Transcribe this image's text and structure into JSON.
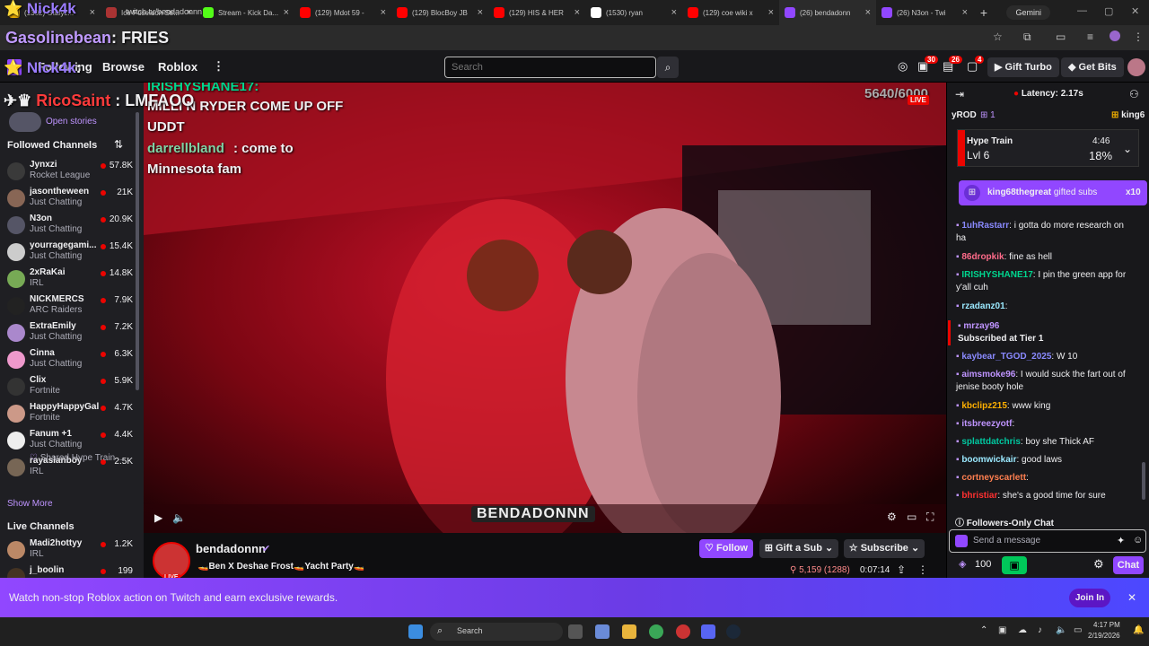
{
  "browser": {
    "tabs": [
      {
        "label": "(1302) Gabyz...",
        "color": "#e6a800"
      },
      {
        "label": "Ice Poseidon Str...",
        "color": "#a33"
      },
      {
        "label": "Stream - Kick Da...",
        "color": "#53fc18"
      },
      {
        "label": "(129) Mdot 59 -",
        "color": "#f00"
      },
      {
        "label": "(129) BlocBoy JB",
        "color": "#f00"
      },
      {
        "label": "(129) HIS & HER",
        "color": "#f00"
      },
      {
        "label": "(1530) ryan",
        "color": "#fff"
      },
      {
        "label": "(129) coe wiki x",
        "color": "#f00"
      },
      {
        "label": "(26) bendadonn",
        "color": "#9147ff"
      },
      {
        "label": "(26) N3on - Twi",
        "color": "#9147ff"
      }
    ],
    "new_tab": "+",
    "gemini": "Gemini",
    "url": "twitch.tv/bendadonnn"
  },
  "overlays": {
    "top_user": "Nick4k",
    "msg1_user": "Gasolinebean",
    "msg1_sep": ":",
    "msg1_text": "FRIES",
    "msg2_user": "Nick4k",
    "msg2_sep": ":",
    "msg3_user": "RicoSaint",
    "msg3_sep": ":",
    "msg3_text": "LMFAOO"
  },
  "nav": {
    "following": "Following",
    "browse": "Browse",
    "roblox": "Roblox",
    "search_placeholder": "Search",
    "badge_a": "30",
    "badge_b": "26",
    "badge_c": "4",
    "gift_turbo": "Gift Turbo",
    "get_bits": "Get Bits"
  },
  "sidebar": {
    "open_stories": "Open stories",
    "followed_header": "Followed Channels",
    "followed": [
      {
        "name": "Jynxzi",
        "game": "Rocket League",
        "viewers": "57.8K",
        "color": "#3a3a3a"
      },
      {
        "name": "jasontheween",
        "game": "Just Chatting",
        "viewers": "21K",
        "color": "#886655"
      },
      {
        "name": "N3on",
        "game": "Just Chatting",
        "viewers": "20.9K",
        "color": "#556"
      },
      {
        "name": "yourragegami...",
        "game": "Just Chatting",
        "viewers": "15.4K",
        "color": "#ccc"
      },
      {
        "name": "2xRaKai",
        "game": "IRL",
        "viewers": "14.8K",
        "color": "#7a5"
      },
      {
        "name": "NICKMERCS",
        "game": "ARC Raiders",
        "viewers": "7.9K",
        "color": "#222"
      },
      {
        "name": "ExtraEmily",
        "game": "Just Chatting",
        "viewers": "7.2K",
        "color": "#a8c"
      },
      {
        "name": "Cinna",
        "game": "Just Chatting",
        "viewers": "6.3K",
        "color": "#e9c"
      },
      {
        "name": "Clix",
        "game": "Fortnite",
        "viewers": "5.9K",
        "color": "#333"
      },
      {
        "name": "HappyHappyGal",
        "game": "Fortnite",
        "viewers": "4.7K",
        "color": "#c98"
      },
      {
        "name": "Fanum +1",
        "game": "Just Chatting",
        "viewers": "4.4K",
        "color": "#eee"
      },
      {
        "name": "rayasianboy",
        "game": "IRL",
        "viewers": "2.5K",
        "color": "#765"
      }
    ],
    "shared_hype": "Shared Hype Train ...",
    "show_more": "Show More",
    "live_header": "Live Channels",
    "live": [
      {
        "name": "Madi2hottyy",
        "game": "IRL",
        "viewers": "1.2K",
        "color": "#b86"
      },
      {
        "name": "j_boolin",
        "game": "",
        "viewers": "199",
        "color": "#432"
      }
    ]
  },
  "video": {
    "chat_overlay_user1": "IRISHYSHANE17:",
    "chat_overlay_msg1a": "MILLI N RYDER COME UP OFF",
    "chat_overlay_msg1b": "UDDT",
    "chat_overlay_user2": "darrellbland",
    "chat_overlay_msg2a": ": come to",
    "chat_overlay_msg2b": "Minnesota fam",
    "goal": "5640/6000",
    "live": "LIVE",
    "watermark": "BENDADONNN"
  },
  "channel": {
    "name": "bendadonnn",
    "title": "🚤Ben X Deshae Frost🚤Yacht Party🚤",
    "follow": "Follow",
    "gift_sub": "Gift a Sub",
    "subscribe": "Subscribe",
    "viewers": "5,159 (1288)",
    "uptime": "0:07:14",
    "avatar_live": "LIVE"
  },
  "chat": {
    "latency": "Latency: 2.17s",
    "top_user1": "yROD",
    "top_gift1": "1",
    "top_user2": "king6",
    "hype_title": "Hype Train",
    "hype_level": "Lvl 6",
    "hype_time": "4:46",
    "hype_pct": "18%",
    "gift_user": "king68thegreat",
    "gift_text": "gifted subs",
    "gift_count": "x10",
    "messages": [
      {
        "user": "1uhRastarr",
        "color": "#8a8aff",
        "text": ": i gotta do more research on ha"
      },
      {
        "user": "86dropkik",
        "color": "#ff6b8a",
        "text": ": fine as hell"
      },
      {
        "user": "IRISHYSHANE17",
        "color": "#00d68f",
        "text": ": I pin the green app for y'all cuh"
      },
      {
        "user": "rzadanz01",
        "color": "#9be9ff",
        "text": ":"
      },
      {
        "user": "mrzay96",
        "color": "#bf94ff",
        "text": "Subscribed at Tier 1"
      },
      {
        "user": "kaybear_TGOD_2025",
        "color": "#8a8aff",
        "text": ": W 10"
      },
      {
        "user": "aimsmoke96",
        "color": "#bf94ff",
        "text": ": I would suck the fart out of jenise booty hole"
      },
      {
        "user": "kbclipz215",
        "color": "#ffb000",
        "text": ": www king"
      },
      {
        "user": "itsbreezyotf",
        "color": "#bf94ff",
        "text": ":"
      },
      {
        "user": "splattdatchris",
        "color": "#00c8a0",
        "text": ": boy she Thick AF"
      },
      {
        "user": "boomwickair",
        "color": "#9be9ff",
        "text": ": good laws"
      },
      {
        "user": "cortneyscarlett",
        "color": "#ff7f50",
        "text": ":"
      },
      {
        "user": "bhristiar",
        "color": "#ff3030",
        "text": ": she's a good time for sure"
      }
    ],
    "followers_only": "Followers-Only Chat",
    "input_placeholder": "Send a message",
    "points": "100",
    "chat_button": "Chat"
  },
  "banner": {
    "text": "Watch non-stop Roblox action on Twitch and earn exclusive rewards.",
    "join": "Join In"
  },
  "taskbar": {
    "search": "Search",
    "time": "4:17 PM",
    "date": "2/19/2026"
  }
}
